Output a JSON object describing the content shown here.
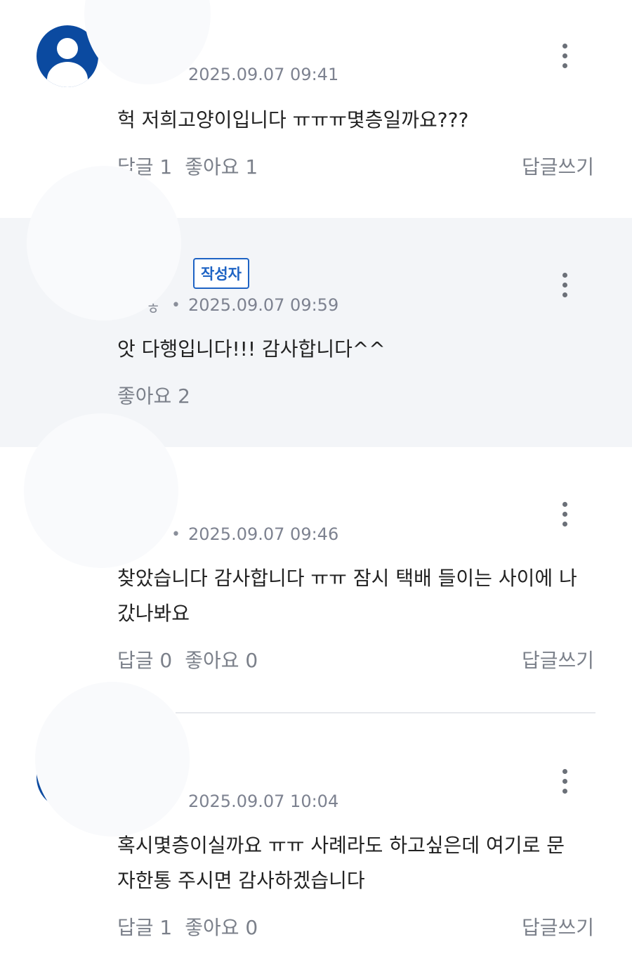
{
  "comments": [
    {
      "timestamp": "2025.09.07 09:41",
      "text": "헉 저희고양이입니다 ㅠㅠㅠ몇층일까요???",
      "reply_count": "답글 1",
      "like_count": "좋아요 1",
      "write_reply": "답글쓰기"
    },
    {
      "badge": "작성자",
      "nickname_fragment": "ㅎ",
      "timestamp": "2025.09.07 09:59",
      "text": "앗 다행입니다!!! 감사합니다^^",
      "like_count": "좋아요 2"
    },
    {
      "timestamp": "2025.09.07 09:46",
      "text_line1": "찾았습니다 감사합니다 ㅠㅠ 잠시 택배 들이는 사이에 나",
      "text_line2": "갔나봐요",
      "reply_count": "답글 0",
      "like_count": "좋아요 0",
      "write_reply": "답글쓰기"
    },
    {
      "timestamp": "2025.09.07 10:04",
      "text_line1": "혹시몇층이실까요 ㅠㅠ 사례라도 하고싶은데 여기로 문",
      "text_line2": "자한통 주시면 감사하겠습니다",
      "reply_count": "답글 1",
      "like_count": "좋아요 0",
      "write_reply": "답글쓰기"
    }
  ],
  "separator": "•",
  "icons": {
    "avatar": "user-avatar-icon",
    "menu": "more-vertical-icon"
  },
  "colors": {
    "avatar_bg": "#0b4aa0",
    "badge": "#1e63c4",
    "reply_bg": "#f3f5f8"
  }
}
